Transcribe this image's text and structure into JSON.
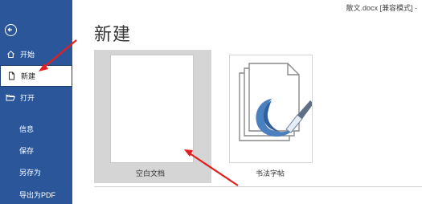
{
  "window": {
    "title": "散文.docx [兼容模式]  -"
  },
  "sidebar": {
    "back_icon": "back-arrow-icon",
    "items": [
      {
        "label": "开始",
        "icon": "home-icon"
      },
      {
        "label": "新建",
        "icon": "new-document-icon",
        "active": true
      },
      {
        "label": "打开",
        "icon": "open-folder-icon"
      }
    ],
    "text_items": [
      "信息",
      "保存",
      "另存为",
      "导出为PDF"
    ]
  },
  "main": {
    "heading": "新建",
    "templates": [
      {
        "label": "空白文档",
        "selected": true
      },
      {
        "label": "书法字帖",
        "icon": "calligraphy-brush-icon"
      }
    ]
  },
  "colors": {
    "sidebar": "#2b579a",
    "arrow": "#e02020",
    "selection": "#d5d5d5"
  }
}
